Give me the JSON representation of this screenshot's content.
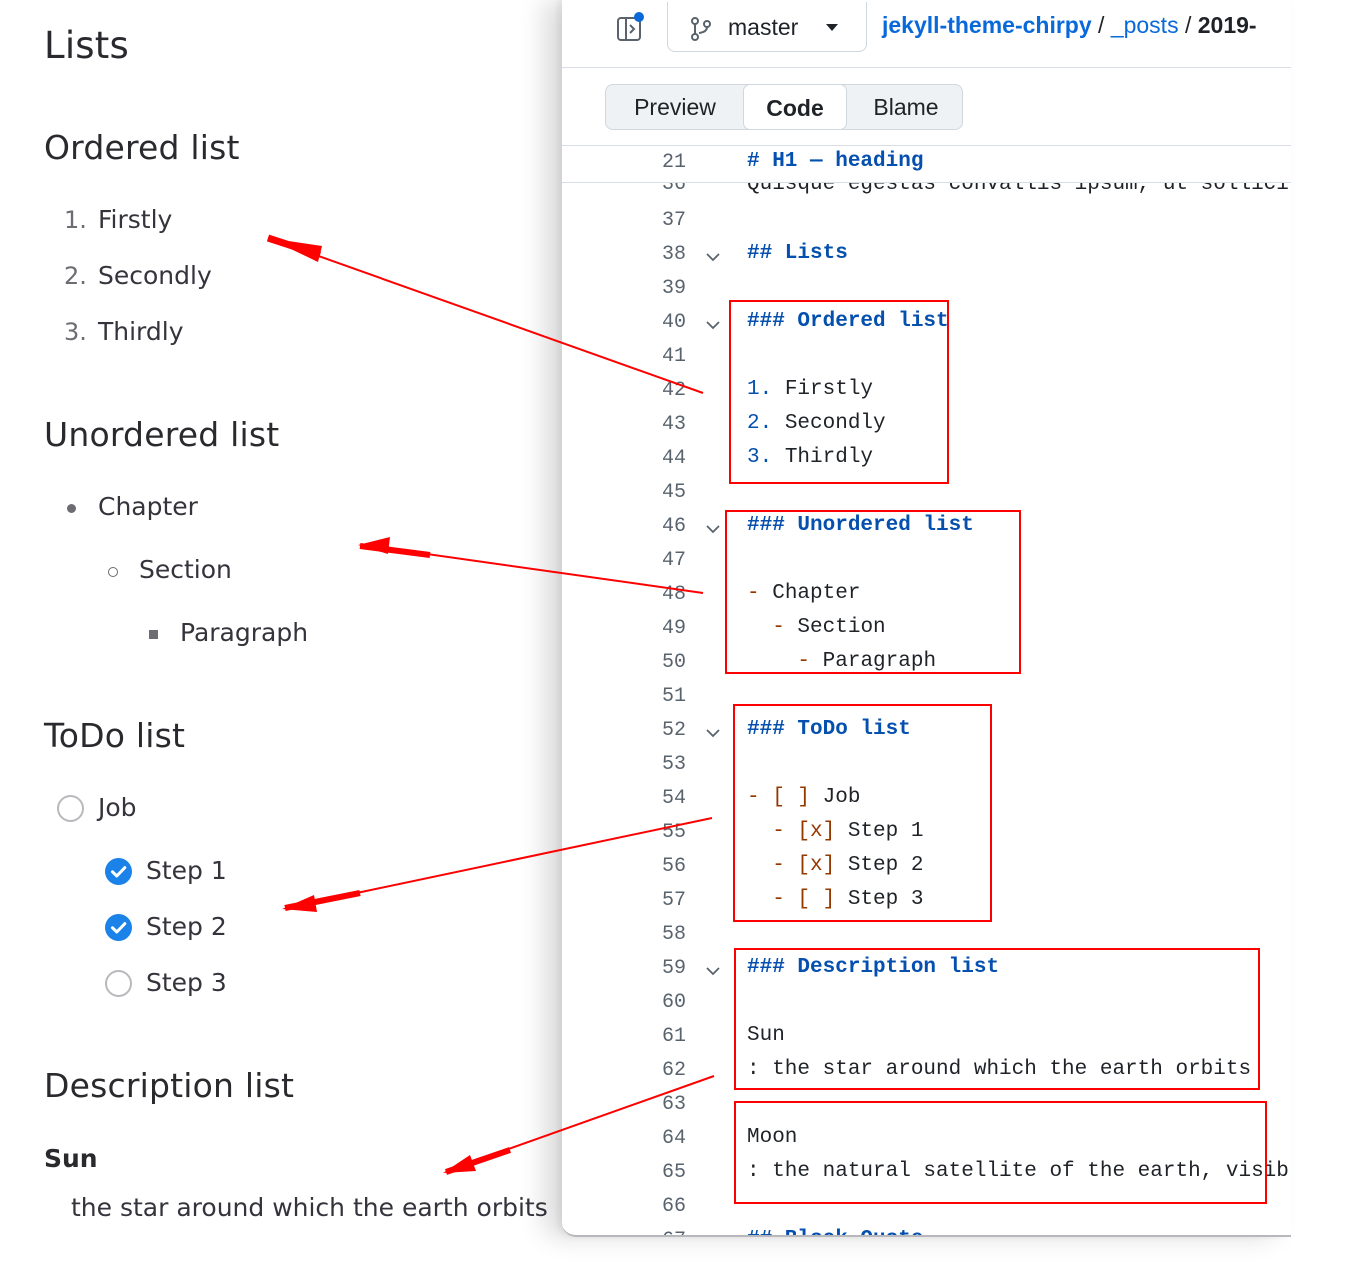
{
  "rendered": {
    "title": "Lists",
    "ordered": {
      "heading": "Ordered list",
      "items": [
        {
          "num": "1.",
          "text": "Firstly"
        },
        {
          "num": "2.",
          "text": "Secondly"
        },
        {
          "num": "3.",
          "text": "Thirdly"
        }
      ]
    },
    "unordered": {
      "heading": "Unordered list",
      "items": [
        "Chapter",
        "Section",
        "Paragraph"
      ]
    },
    "todo": {
      "heading": "ToDo list",
      "items": [
        {
          "text": "Job",
          "checked": false
        },
        {
          "text": "Step 1",
          "checked": true
        },
        {
          "text": "Step 2",
          "checked": true
        },
        {
          "text": "Step 3",
          "checked": false
        }
      ]
    },
    "description": {
      "heading": "Description list",
      "term": "Sun",
      "definition": "the star around which the earth orbits"
    }
  },
  "github": {
    "branch": "master",
    "breadcrumb": {
      "repo": "jekyll-theme-chirpy",
      "sep1": " / ",
      "folder": "_posts",
      "sep2": " / ",
      "file": "2019-"
    },
    "tabs": {
      "preview": "Preview",
      "code": "Code",
      "blame": "Blame"
    },
    "sticky_line": {
      "num": "21",
      "text": "# H1 — heading"
    },
    "partial_line": {
      "num": "36",
      "text": "Quisque egestas convallis ipsum, ut sollicit"
    },
    "lines": [
      {
        "num": "37",
        "segs": []
      },
      {
        "num": "38",
        "fold": true,
        "segs": [
          {
            "c": "hd",
            "t": "## Lists"
          }
        ]
      },
      {
        "num": "39",
        "segs": []
      },
      {
        "num": "40",
        "fold": true,
        "segs": [
          {
            "c": "hd",
            "t": "### Ordered list"
          }
        ]
      },
      {
        "num": "41",
        "segs": []
      },
      {
        "num": "42",
        "segs": [
          {
            "c": "num",
            "t": "1."
          },
          {
            "c": "",
            "t": " Firstly"
          }
        ]
      },
      {
        "num": "43",
        "segs": [
          {
            "c": "num",
            "t": "2."
          },
          {
            "c": "",
            "t": " Secondly"
          }
        ]
      },
      {
        "num": "44",
        "segs": [
          {
            "c": "num",
            "t": "3."
          },
          {
            "c": "",
            "t": " Thirdly"
          }
        ]
      },
      {
        "num": "45",
        "segs": []
      },
      {
        "num": "46",
        "fold": true,
        "segs": [
          {
            "c": "hd",
            "t": "### Unordered list"
          }
        ]
      },
      {
        "num": "47",
        "segs": []
      },
      {
        "num": "48",
        "segs": [
          {
            "c": "mk",
            "t": "-"
          },
          {
            "c": "",
            "t": " Chapter"
          }
        ]
      },
      {
        "num": "49",
        "segs": [
          {
            "c": "",
            "t": "  "
          },
          {
            "c": "mk",
            "t": "-"
          },
          {
            "c": "",
            "t": " Section"
          }
        ]
      },
      {
        "num": "50",
        "segs": [
          {
            "c": "",
            "t": "    "
          },
          {
            "c": "mk",
            "t": "-"
          },
          {
            "c": "",
            "t": " Paragraph"
          }
        ]
      },
      {
        "num": "51",
        "segs": []
      },
      {
        "num": "52",
        "fold": true,
        "segs": [
          {
            "c": "hd",
            "t": "### ToDo list"
          }
        ]
      },
      {
        "num": "53",
        "segs": []
      },
      {
        "num": "54",
        "segs": [
          {
            "c": "mk",
            "t": "- [ ]"
          },
          {
            "c": "",
            "t": " Job"
          }
        ]
      },
      {
        "num": "55",
        "segs": [
          {
            "c": "",
            "t": "  "
          },
          {
            "c": "mk",
            "t": "- [x]"
          },
          {
            "c": "",
            "t": " Step 1"
          }
        ]
      },
      {
        "num": "56",
        "segs": [
          {
            "c": "",
            "t": "  "
          },
          {
            "c": "mk",
            "t": "- [x]"
          },
          {
            "c": "",
            "t": " Step 2"
          }
        ]
      },
      {
        "num": "57",
        "segs": [
          {
            "c": "",
            "t": "  "
          },
          {
            "c": "mk",
            "t": "- [ ]"
          },
          {
            "c": "",
            "t": " Step 3"
          }
        ]
      },
      {
        "num": "58",
        "segs": []
      },
      {
        "num": "59",
        "fold": true,
        "segs": [
          {
            "c": "hd",
            "t": "### Description list"
          }
        ]
      },
      {
        "num": "60",
        "segs": []
      },
      {
        "num": "61",
        "segs": [
          {
            "c": "",
            "t": "Sun"
          }
        ]
      },
      {
        "num": "62",
        "segs": [
          {
            "c": "",
            "t": ": the star around which the earth orbits"
          }
        ]
      },
      {
        "num": "63",
        "segs": []
      },
      {
        "num": "64",
        "segs": [
          {
            "c": "",
            "t": "Moon"
          }
        ]
      },
      {
        "num": "65",
        "segs": [
          {
            "c": "",
            "t": ": the natural satellite of the earth, visibl"
          }
        ]
      },
      {
        "num": "66",
        "segs": []
      },
      {
        "num": "67",
        "segs": [
          {
            "c": "hd",
            "t": "## Block Quote"
          }
        ]
      }
    ]
  },
  "colors": {
    "annotation": "#ff0000",
    "link": "#0969da",
    "check": "#1a82e8",
    "heading_code": "#0550ae",
    "marker_code": "#953800"
  }
}
